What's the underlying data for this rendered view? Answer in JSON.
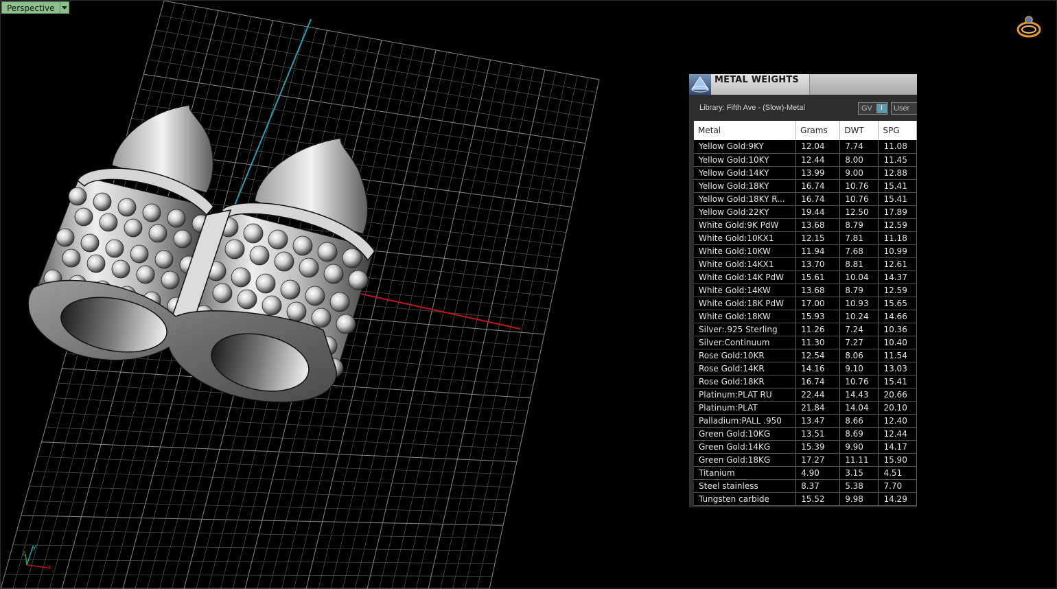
{
  "viewport": {
    "name": "Perspective",
    "axis_labels": {
      "x": "x",
      "y": "y",
      "z": "z"
    },
    "colors": {
      "x_axis": "#c01818",
      "y_axis": "#2aa0b0",
      "grid": "#6a6a6a"
    }
  },
  "panel": {
    "title": "METAL WEIGHTS",
    "library_label": "Library: Fifth Ave - (Slow)-Metal",
    "gv_label": "GV",
    "gv_toggle": "I",
    "user_label": "User",
    "columns": [
      "Metal",
      "Grams",
      "DWT",
      "SPG"
    ],
    "rows": [
      [
        "Yellow Gold:9KY",
        "12.04",
        "7.74",
        "11.08"
      ],
      [
        "Yellow Gold:10KY",
        "12.44",
        "8.00",
        "11.45"
      ],
      [
        "Yellow Gold:14KY",
        "13.99",
        "9.00",
        "12.88"
      ],
      [
        "Yellow Gold:18KY",
        "16.74",
        "10.76",
        "15.41"
      ],
      [
        "Yellow Gold:18KY R...",
        "16.74",
        "10.76",
        "15.41"
      ],
      [
        "Yellow Gold:22KY",
        "19.44",
        "12.50",
        "17.89"
      ],
      [
        "White Gold:9K PdW",
        "13.68",
        "8.79",
        "12.59"
      ],
      [
        "White Gold:10KX1",
        "12.15",
        "7.81",
        "11.18"
      ],
      [
        "White Gold:10KW",
        "11.94",
        "7.68",
        "10.99"
      ],
      [
        "White Gold:14KX1",
        "13.70",
        "8.81",
        "12.61"
      ],
      [
        "White Gold:14K PdW",
        "15.61",
        "10.04",
        "14.37"
      ],
      [
        "White Gold:14KW",
        "13.68",
        "8.79",
        "12.59"
      ],
      [
        "White Gold:18K PdW",
        "17.00",
        "10.93",
        "15.65"
      ],
      [
        "White Gold:18KW",
        "15.93",
        "10.24",
        "14.66"
      ],
      [
        "Silver:.925 Sterling",
        "11.26",
        "7.24",
        "10.36"
      ],
      [
        "Silver:Continuum",
        "11.30",
        "7.27",
        "10.40"
      ],
      [
        "Rose Gold:10KR",
        "12.54",
        "8.06",
        "11.54"
      ],
      [
        "Rose Gold:14KR",
        "14.16",
        "9.10",
        "13.03"
      ],
      [
        "Rose Gold:18KR",
        "16.74",
        "10.76",
        "15.41"
      ],
      [
        "Platinum:PLAT RU",
        "22.44",
        "14.43",
        "20.66"
      ],
      [
        "Platinum:PLAT",
        "21.84",
        "14.04",
        "20.10"
      ],
      [
        "Palladium:PALL .950",
        "13.47",
        "8.66",
        "12.40"
      ],
      [
        "Green Gold:10KG",
        "13.51",
        "8.69",
        "12.44"
      ],
      [
        "Green Gold:14KG",
        "15.39",
        "9.90",
        "14.17"
      ],
      [
        "Green Gold:18KG",
        "17.27",
        "11.11",
        "15.90"
      ],
      [
        "Titanium",
        "4.90",
        "3.15",
        "4.51"
      ],
      [
        "Steel stainless",
        "8.37",
        "5.38",
        "7.70"
      ],
      [
        "Tungsten carbide",
        "15.52",
        "9.98",
        "14.29"
      ]
    ]
  }
}
